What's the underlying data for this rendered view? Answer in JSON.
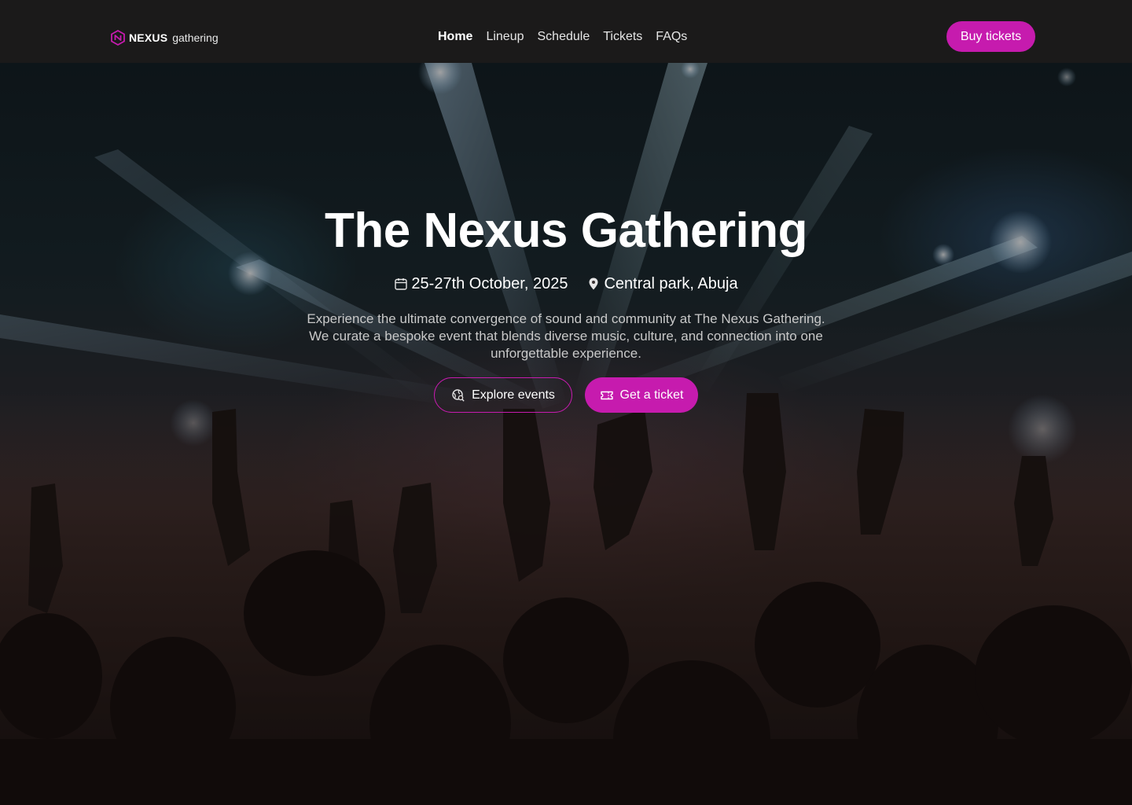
{
  "brand": {
    "name_strong": "NEXUS",
    "name_light": "gathering",
    "accent": "#c61bae"
  },
  "nav": {
    "links": [
      "Home",
      "Lineup",
      "Schedule",
      "Tickets",
      "FAQs"
    ],
    "active": "Home",
    "cta_label": "Buy tickets"
  },
  "hero": {
    "title": "The Nexus Gathering",
    "date": "25-27th October, 2025",
    "location": "Central park, Abuja",
    "description": "Experience the ultimate convergence of sound and community at The Nexus Gathering. We curate a bespoke event that blends diverse music,  culture, and connection into one unforgettable experience.",
    "primary_button": "Get a ticket",
    "secondary_button": "Explore events",
    "icons": {
      "date": "calendar-icon",
      "location": "map-pin-icon",
      "explore": "globe-search-icon",
      "ticket": "ticket-icon"
    }
  },
  "colors": {
    "nav_bg": "#1b1a1a",
    "button": "#c61bae",
    "text": "#ffffff",
    "muted_text": "#c9c9c9"
  }
}
